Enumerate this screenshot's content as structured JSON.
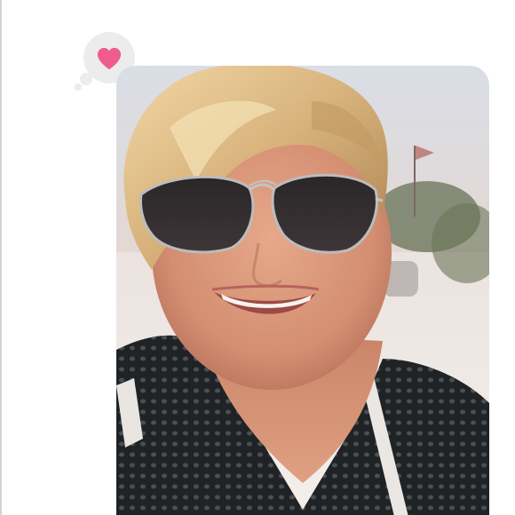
{
  "header": {
    "partial_text": "· · · · · · ·"
  },
  "reaction": {
    "icon": "heart-icon",
    "color": "#f05c8e",
    "bubble_color": "#ececec"
  },
  "message": {
    "type": "photo",
    "image": "selfie-photo"
  }
}
